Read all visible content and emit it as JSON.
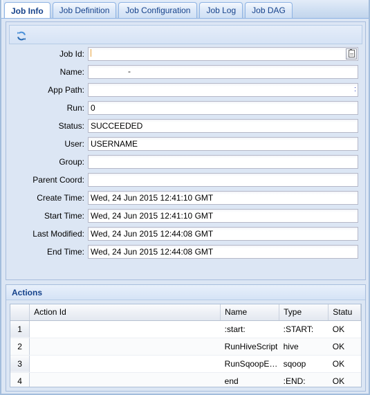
{
  "tabs": [
    {
      "label": "Job Info",
      "active": true
    },
    {
      "label": "Job Definition",
      "active": false
    },
    {
      "label": "Job Configuration",
      "active": false
    },
    {
      "label": "Job Log",
      "active": false
    },
    {
      "label": "Job DAG",
      "active": false
    }
  ],
  "toolbar": {
    "refresh_icon": "refresh-icon",
    "refresh_title": "Refresh"
  },
  "job_info": {
    "fields": [
      {
        "label": "Job Id:",
        "value": "",
        "has_button": true
      },
      {
        "label": "Name:",
        "value": "",
        "has_button": false,
        "dash": "-"
      },
      {
        "label": "App Path:",
        "value": "",
        "has_button": false,
        "overflow_char": ":"
      },
      {
        "label": "Run:",
        "value": "0",
        "has_button": false
      },
      {
        "label": "Status:",
        "value": "SUCCEEDED",
        "has_button": false
      },
      {
        "label": "User:",
        "value": "USERNAME",
        "has_button": false
      },
      {
        "label": "Group:",
        "value": "",
        "has_button": false
      },
      {
        "label": "Parent Coord:",
        "value": "",
        "has_button": false
      },
      {
        "label": "Create Time:",
        "value": "Wed, 24 Jun 2015 12:41:10 GMT",
        "has_button": false
      },
      {
        "label": "Start Time:",
        "value": "Wed, 24 Jun 2015 12:41:10 GMT",
        "has_button": false
      },
      {
        "label": "Last Modified:",
        "value": "Wed, 24 Jun 2015 12:44:08 GMT",
        "has_button": false
      },
      {
        "label": "End Time:",
        "value": "Wed, 24 Jun 2015 12:44:08 GMT",
        "has_button": false
      }
    ]
  },
  "actions": {
    "title": "Actions",
    "columns": [
      "Action Id",
      "Name",
      "Type",
      "Statu"
    ],
    "rows": [
      {
        "num": "1",
        "action_id": "",
        "name": ":start:",
        "type": ":START:",
        "status": "OK"
      },
      {
        "num": "2",
        "action_id": "",
        "name": "RunHiveScript",
        "type": "hive",
        "status": "OK"
      },
      {
        "num": "3",
        "action_id": "",
        "name": "RunSqoopE…",
        "type": "sqoop",
        "status": "OK"
      },
      {
        "num": "4",
        "action_id": "",
        "name": "end",
        "type": ":END:",
        "status": "OK"
      }
    ]
  },
  "colors": {
    "accent": "#15428b",
    "panel_bg": "#dce6f4",
    "border": "#a7bddd"
  }
}
